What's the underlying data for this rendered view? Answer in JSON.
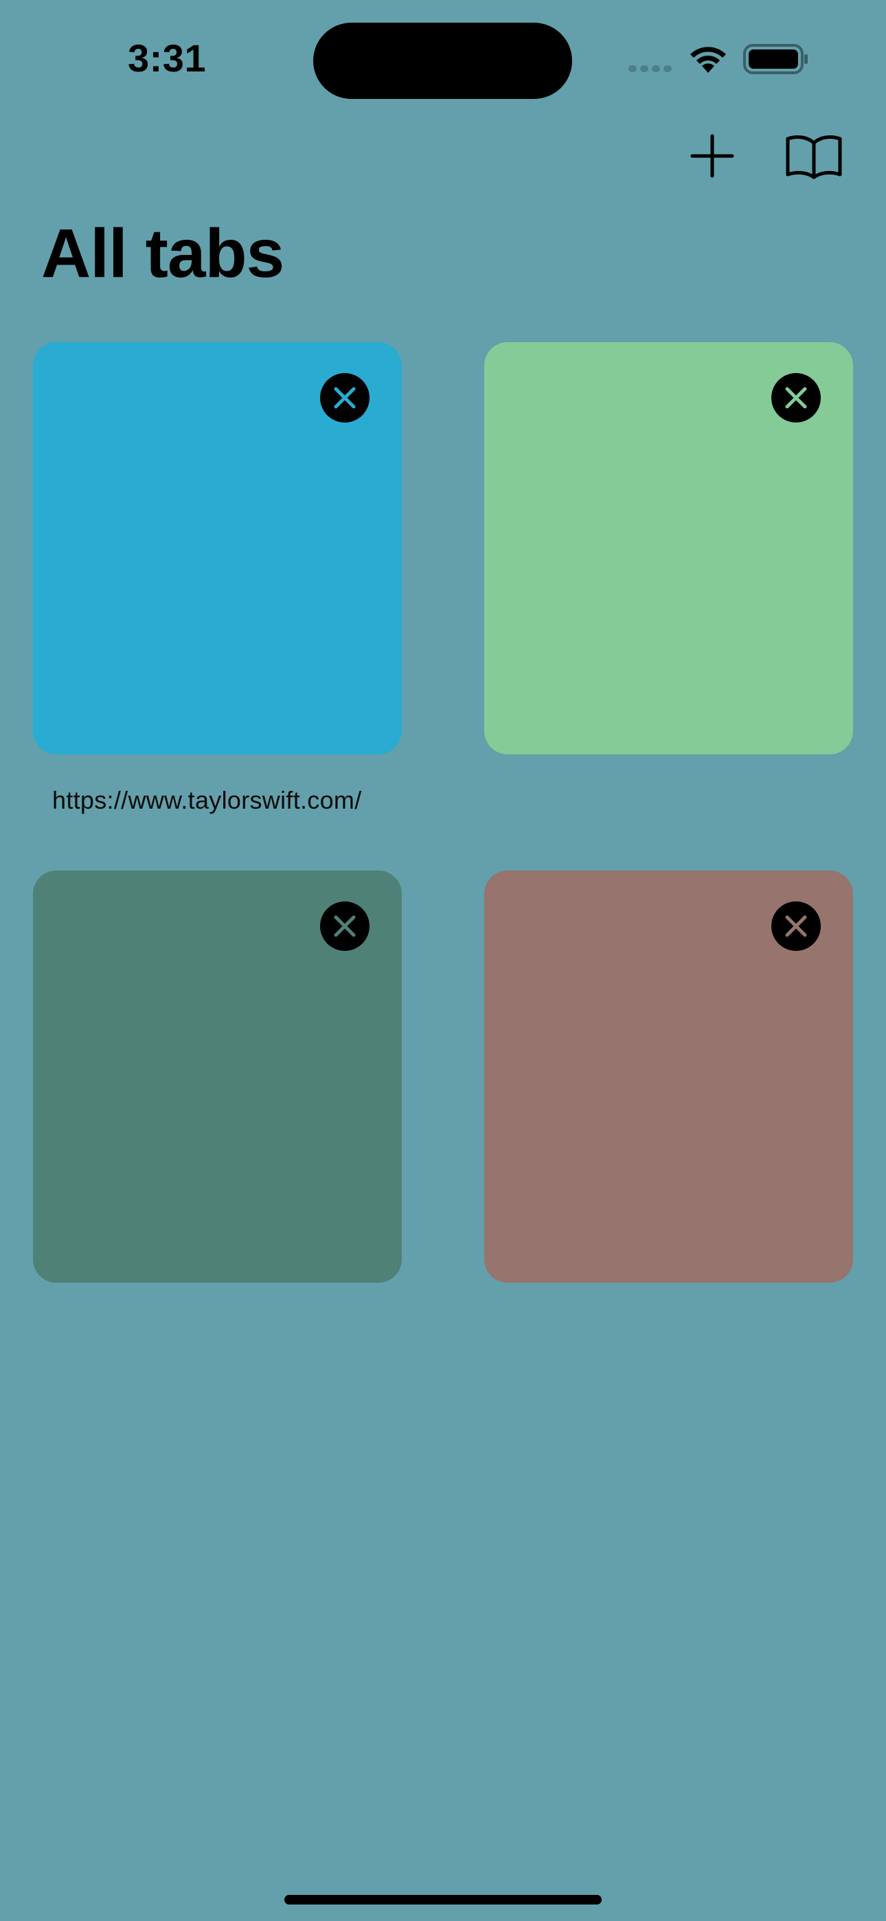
{
  "status_bar": {
    "time": "3:31"
  },
  "toolbar": {
    "add_icon": "plus-icon",
    "bookmarks_icon": "book-icon"
  },
  "page": {
    "title": "All tabs"
  },
  "tabs": [
    {
      "color": "#2AABD2",
      "close_icon": "close-icon",
      "url": "https://www.taylorswift.com/"
    },
    {
      "color": "#84CB97",
      "close_icon": "close-icon",
      "url": ""
    },
    {
      "color": "#4F8177",
      "close_icon": "close-icon",
      "url": ""
    },
    {
      "color": "#97746D",
      "close_icon": "close-icon",
      "url": ""
    }
  ],
  "colors": {
    "background": "#63A0AB",
    "text": "#000000"
  }
}
